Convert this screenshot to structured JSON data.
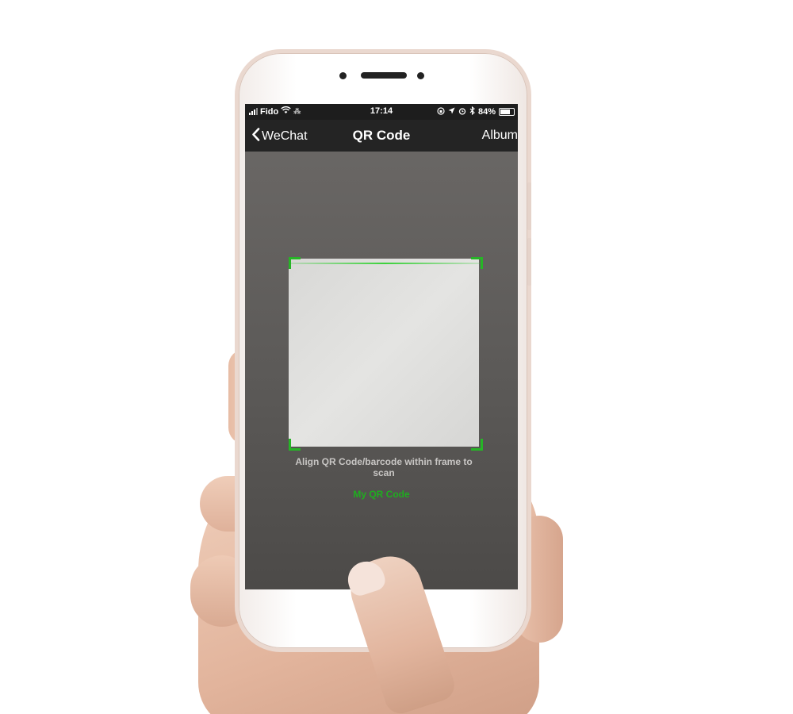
{
  "status_bar": {
    "carrier": "Fido",
    "time": "17:14",
    "battery": "84%",
    "battery_level": 0.84,
    "icons": [
      "signal-icon",
      "wifi-icon",
      "activity-icon",
      "lock-rotation-icon",
      "location-icon",
      "alarm-icon",
      "bluetooth-icon",
      "battery-icon"
    ]
  },
  "nav": {
    "back_label": "WeChat",
    "title": "QR Code",
    "album_label": "Album"
  },
  "scanner": {
    "hint": "Align QR Code/barcode within frame to scan",
    "my_qr_label": "My QR Code"
  },
  "colors": {
    "accent_green": "#1fad1f",
    "navbar_bg": "#242424",
    "statusbar_bg": "#1d1d1d",
    "frame_corner": "#26b526"
  }
}
